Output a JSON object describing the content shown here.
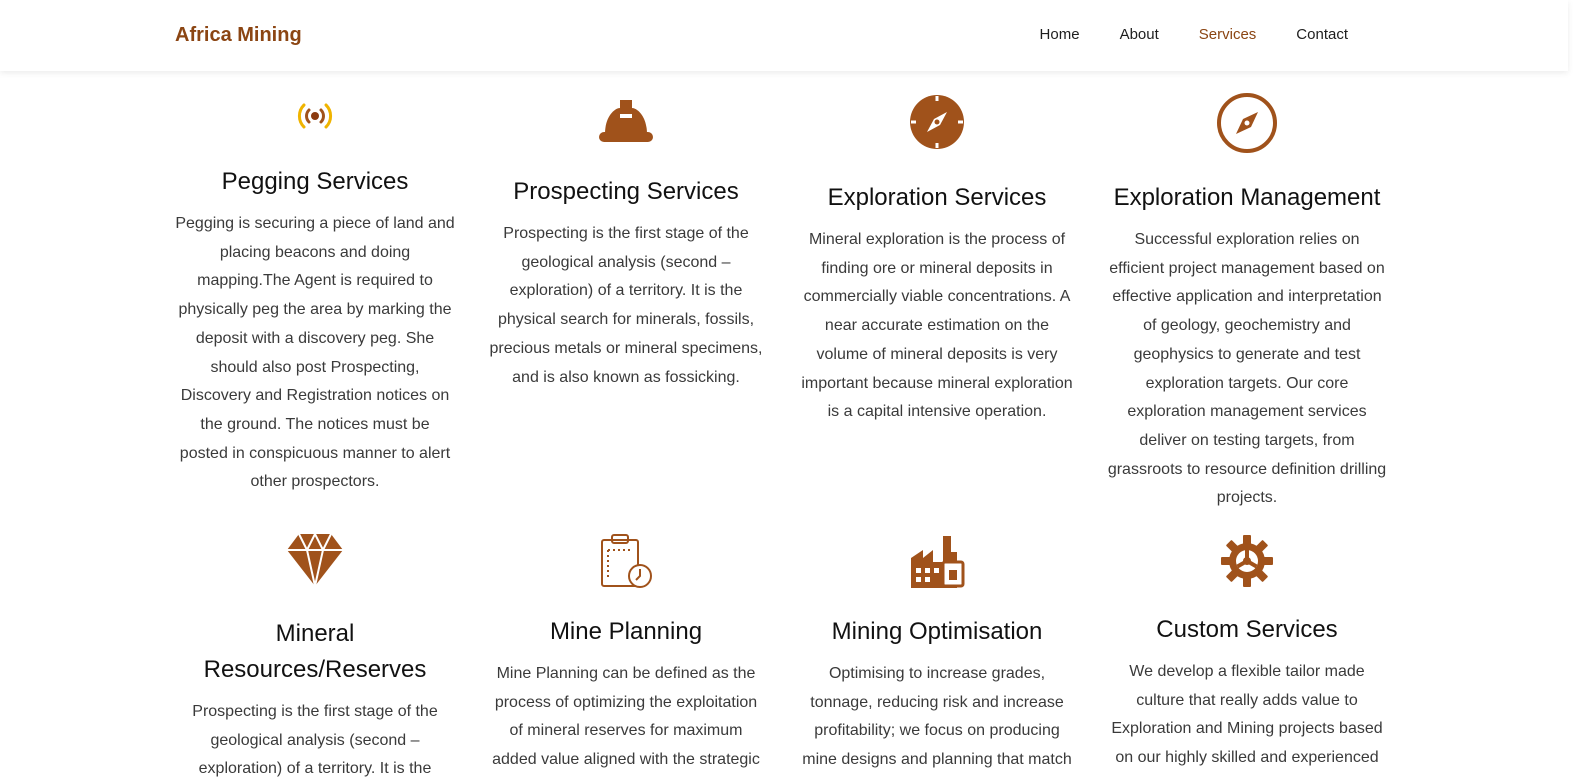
{
  "brand": "Africa Mining",
  "nav": {
    "items": [
      "Home",
      "About",
      "Services",
      "Contact"
    ],
    "active": "Services"
  },
  "colors": {
    "brand": "#8b4513",
    "icon": "#a0521b",
    "signal_accent": "#f0b400"
  },
  "services": [
    {
      "icon": "broadcast-signal-icon",
      "title": "Pegging Services",
      "text": "Pegging is securing a piece of land and placing beacons and doing mapping.The Agent is required to physically peg the area by marking the deposit with a discovery peg. She should also post Prospecting, Discovery and Registration notices on the ground. The notices must be posted in conspicuous manner to alert other prospectors."
    },
    {
      "icon": "hard-hat-icon",
      "title": "Prospecting Services",
      "text": "Prospecting is the first stage of the geological analysis (second – exploration) of a territory. It is the physical search for minerals, fossils, precious metals or mineral specimens, and is also known as fossicking."
    },
    {
      "icon": "compass-filled-icon",
      "title": "Exploration Services",
      "text": "Mineral exploration is the process of finding ore or mineral deposits in commercially viable concentrations. A near accurate estimation on the volume of mineral deposits is very important because mineral exploration is a capital intensive operation."
    },
    {
      "icon": "compass-outline-icon",
      "title": "Exploration Management",
      "text": "Successful exploration relies on efficient project management based on effective application and interpretation of geology, geochemistry and geophysics to generate and test exploration targets. Our core exploration management services deliver on testing targets, from grassroots to resource definition drilling projects."
    },
    {
      "icon": "diamond-icon",
      "title": "Mineral Resources/Reserves",
      "text": "Prospecting is the first stage of the geological analysis (second – exploration) of a territory. It is the"
    },
    {
      "icon": "clipboard-clock-icon",
      "title": "Mine Planning",
      "text": "Mine Planning can be defined as the process of optimizing the exploitation of mineral reserves for maximum added value aligned with the strategic"
    },
    {
      "icon": "factory-icon",
      "title": "Mining Optimisation",
      "text": "Optimising to increase grades, tonnage, reducing risk and increase profitability; we focus on producing mine designs and planning that match"
    },
    {
      "icon": "gear-icon",
      "title": "Custom Services",
      "text": "We develop a flexible tailor made culture that really adds value to Exploration and Mining projects based on our highly skilled and experienced"
    }
  ]
}
